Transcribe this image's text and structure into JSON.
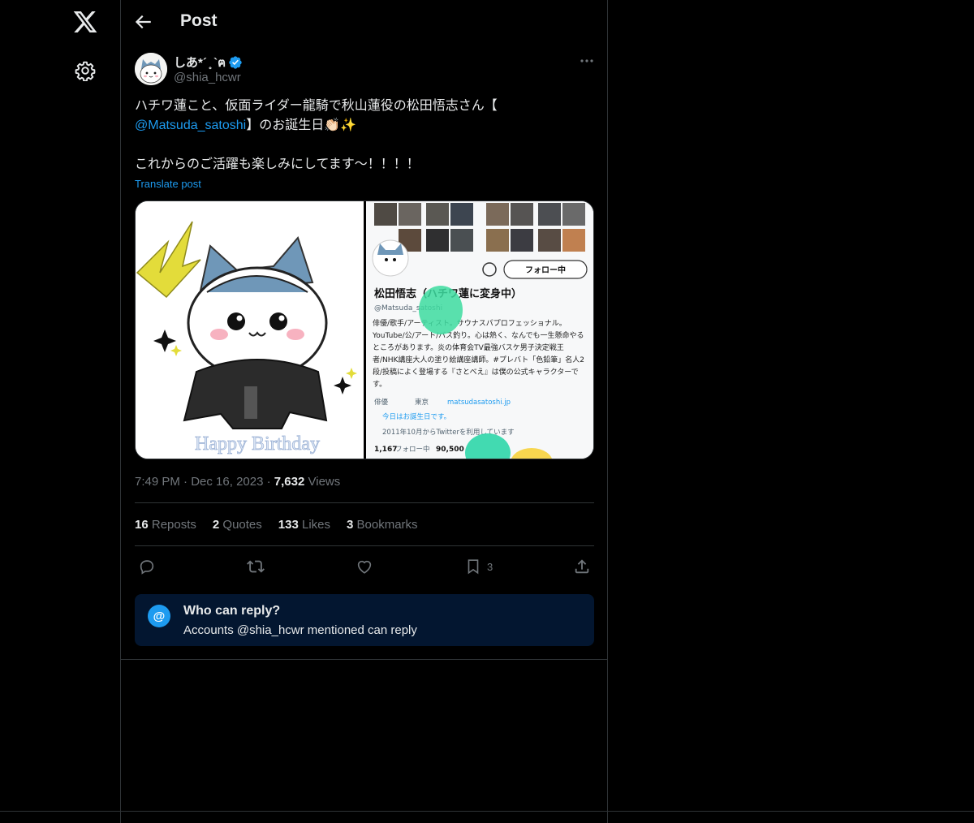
{
  "header": {
    "title": "Post"
  },
  "author": {
    "display_name": "しあ*´ ̥̥ `ฅ",
    "handle": "@shia_hcwr"
  },
  "tweet": {
    "text_line1": "ハチワ蓮こと、仮面ライダー龍騎で秋山蓮役の松田悟志さん【",
    "mention": "@Matsuda_satoshi",
    "text_line2_rest": "】のお誕生日👏🏻✨",
    "text_line3": "これからのご活躍も楽しみにしてます〜！！！！",
    "translate_label": "Translate post",
    "media": {
      "left_caption": "Happy Birthday",
      "right_name": "松田悟志（ハチワ蓮に変身中）",
      "right_handle": "@Matsuda_satoshi",
      "right_bio": "俳優/歌手/アーティスト。サウナスパプロフェッショナル。YouTube/公/アート/バス釣り。心は熱く、なんでも一生懸命やるところがあります。炎の体育会TV最強バスケ男子決定戦王者/NHK講座大人の塗り絵講座講師。#プレバト「色鉛筆」名人2段/投稿によく登場する『さとべえ』は僕の公式キャラクターです。",
      "right_follow_button": "フォロー中",
      "right_meta1": "俳優",
      "right_meta2": "東京",
      "right_link": "matsudasatoshi.jp",
      "right_birthday": "今日はお誕生日です。",
      "right_joined": "2011年10月からTwitterを利用しています",
      "right_following": "1,167",
      "right_following_label": "フォロー中",
      "right_followers": "90,500"
    }
  },
  "meta": {
    "time": "7:49 PM",
    "dot1": "·",
    "date": "Dec 16, 2023",
    "dot2": "·",
    "views_count": "7,632",
    "views_label": "Views"
  },
  "stats": {
    "reposts_count": "16",
    "reposts_label": "Reposts",
    "quotes_count": "2",
    "quotes_label": "Quotes",
    "likes_count": "133",
    "likes_label": "Likes",
    "bookmarks_count": "3",
    "bookmarks_label": "Bookmarks"
  },
  "actions": {
    "bookmark_count": "3"
  },
  "reply_restriction": {
    "at_symbol": "@",
    "title": "Who can reply?",
    "subtitle": "Accounts @shia_hcwr mentioned can reply"
  },
  "colors": {
    "background": "#000000",
    "accent": "#1d9bf0",
    "muted": "#71767b",
    "border": "#2f3336",
    "reply_box": "#031630"
  },
  "icons": [
    "x-logo-icon",
    "gear-icon",
    "back-arrow-icon",
    "verified-badge-icon",
    "more-icon",
    "reply-icon",
    "repost-icon",
    "like-icon",
    "bookmark-icon",
    "share-icon"
  ]
}
